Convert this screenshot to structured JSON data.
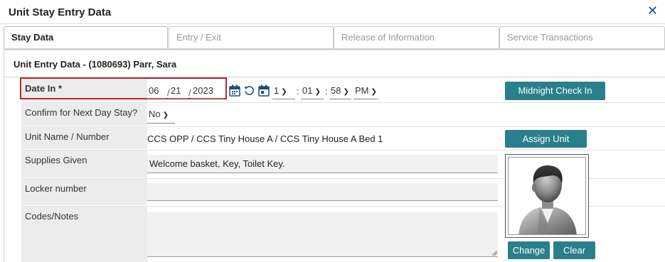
{
  "window": {
    "title": "Unit Stay Entry Data",
    "close_glyph": "✕"
  },
  "tabs": [
    {
      "label": "Stay Data",
      "active": true
    },
    {
      "label": "Entry / Exit",
      "active": false
    },
    {
      "label": "Release of Information",
      "active": false
    },
    {
      "label": "Service Transactions",
      "active": false
    }
  ],
  "section": {
    "title": "Unit Entry Data - (1080693) Parr, Sara"
  },
  "fields": {
    "date_in": {
      "label": "Date In *",
      "month": "06",
      "day": "21",
      "year": "2023",
      "sep": "/",
      "hour": "1",
      "minute": "01",
      "second": "58",
      "ampm": "PM",
      "time_sep": ":"
    },
    "confirm_next_day": {
      "label": "Confirm for Next Day Stay?",
      "value": "No"
    },
    "unit_name": {
      "label": "Unit Name / Number",
      "value": "CCS OPP / CCS Tiny House A / CCS Tiny House A Bed 1"
    },
    "supplies_given": {
      "label": "Supplies Given",
      "value": "Welcome basket, Key, Toilet Key."
    },
    "locker_number": {
      "label": "Locker number",
      "value": ""
    },
    "codes_notes": {
      "label": "Codes/Notes",
      "value": ""
    }
  },
  "buttons": {
    "midnight_check_in": "Midnight Check In",
    "assign_unit": "Assign Unit",
    "change": "Change",
    "clear": "Clear"
  },
  "icons": {
    "calendar": "calendar-icon",
    "reset": "undo-icon",
    "avatar": "person-silhouette-icon"
  },
  "colors": {
    "accent": "#2a7f8c",
    "required_border": "#c0262d",
    "label_bg": "#ececec"
  }
}
